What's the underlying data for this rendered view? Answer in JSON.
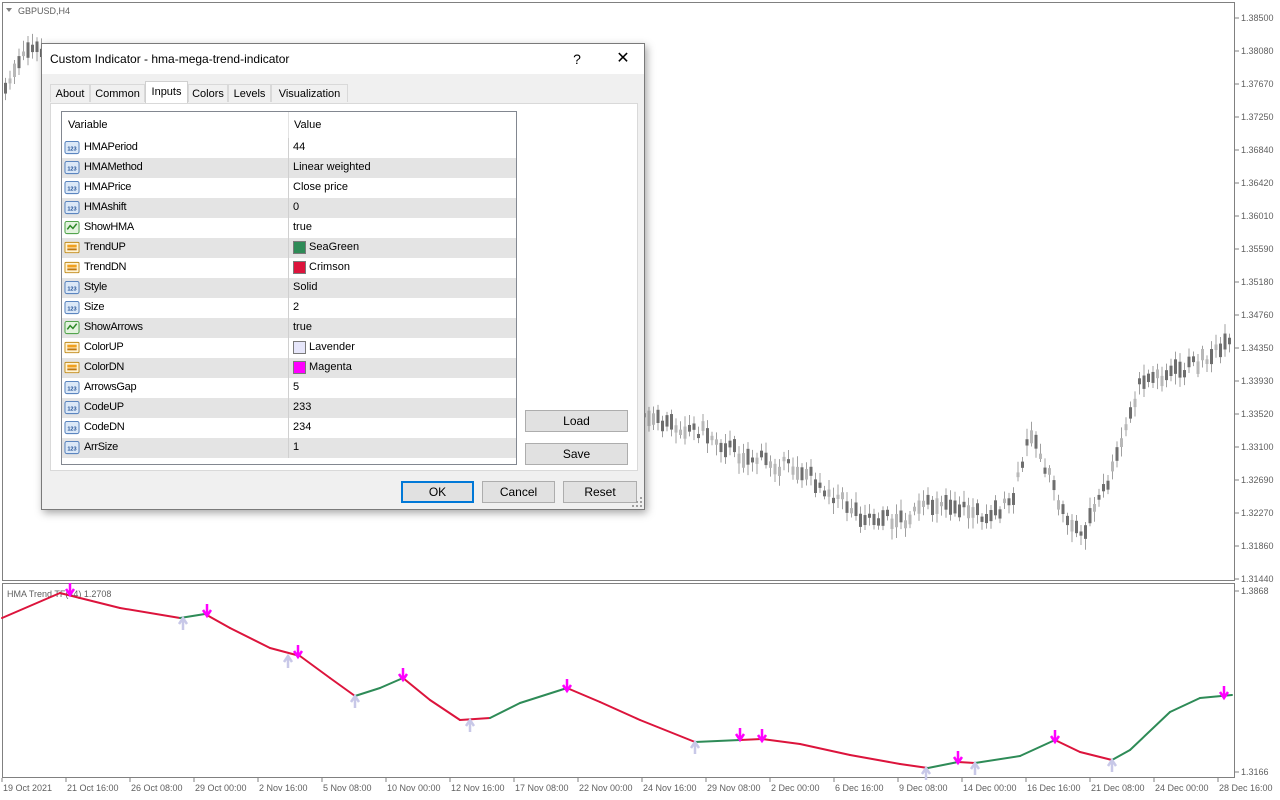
{
  "main_chart": {
    "symbol_label": "GBPUSD,H4",
    "price_ticks": [
      "1.38500",
      "1.38080",
      "1.37670",
      "1.37250",
      "1.36840",
      "1.36420",
      "1.36010",
      "1.35590",
      "1.35180",
      "1.34760",
      "1.34350",
      "1.33930",
      "1.33520",
      "1.33100",
      "1.32690",
      "1.32270",
      "1.31860",
      "1.31440"
    ]
  },
  "indicator_panel": {
    "label": "HMA Trend TF(44) 1.2708",
    "top_value": "1.3868",
    "bottom_value": "1.3166"
  },
  "time_axis": [
    "19 Oct 2021",
    "21 Oct 16:00",
    "26 Oct 08:00",
    "29 Oct 00:00",
    "2 Nov 16:00",
    "5 Nov 08:00",
    "10 Nov 00:00",
    "12 Nov 16:00",
    "17 Nov 08:00",
    "22 Nov 00:00",
    "24 Nov 16:00",
    "29 Nov 08:00",
    "2 Dec 00:00",
    "6 Dec 16:00",
    "9 Dec 08:00",
    "14 Dec 00:00",
    "16 Dec 16:00",
    "21 Dec 08:00",
    "24 Dec 00:00",
    "28 Dec 16:00"
  ],
  "colors": {
    "trend_up": "#2e8b57",
    "trend_dn": "#dc143c",
    "arrow_up": "#e6e6fa",
    "arrow_dn": "#ff00ff",
    "focus_border": "#0078d7"
  },
  "dialog": {
    "title": "Custom Indicator - hma-mega-trend-indicator",
    "help": "?",
    "close": "✕",
    "tabs": [
      "About",
      "Common",
      "Inputs",
      "Colors",
      "Levels",
      "Visualization"
    ],
    "active_tab": "Inputs",
    "grid": {
      "header_variable": "Variable",
      "header_value": "Value",
      "rows": [
        {
          "variable": "HMAPeriod",
          "value": "44",
          "icon": "number-icon"
        },
        {
          "variable": "HMAMethod",
          "value": "Linear weighted",
          "icon": "number-icon"
        },
        {
          "variable": "HMAPrice",
          "value": "Close price",
          "icon": "number-icon"
        },
        {
          "variable": "HMAshift",
          "value": "0",
          "icon": "number-icon"
        },
        {
          "variable": "ShowHMA",
          "value": "true",
          "icon": "boolean-icon"
        },
        {
          "variable": "TrendUP",
          "value": "SeaGreen",
          "icon": "color-icon",
          "swatch": "#2e8b57"
        },
        {
          "variable": "TrendDN",
          "value": "Crimson",
          "icon": "color-icon",
          "swatch": "#dc143c"
        },
        {
          "variable": "Style",
          "value": "Solid",
          "icon": "number-icon"
        },
        {
          "variable": "Size",
          "value": "2",
          "icon": "number-icon"
        },
        {
          "variable": "ShowArrows",
          "value": "true",
          "icon": "boolean-icon"
        },
        {
          "variable": "ColorUP",
          "value": "Lavender",
          "icon": "color-icon",
          "swatch": "#e6e6fa"
        },
        {
          "variable": "ColorDN",
          "value": "Magenta",
          "icon": "color-icon",
          "swatch": "#ff00ff"
        },
        {
          "variable": "ArrowsGap",
          "value": "5",
          "icon": "number-icon"
        },
        {
          "variable": "CodeUP",
          "value": "233",
          "icon": "number-icon"
        },
        {
          "variable": "CodeDN",
          "value": "234",
          "icon": "number-icon"
        },
        {
          "variable": "ArrSize",
          "value": "1",
          "icon": "number-icon"
        }
      ]
    },
    "buttons": {
      "load": "Load",
      "save": "Save",
      "ok": "OK",
      "cancel": "Cancel",
      "reset": "Reset"
    }
  }
}
